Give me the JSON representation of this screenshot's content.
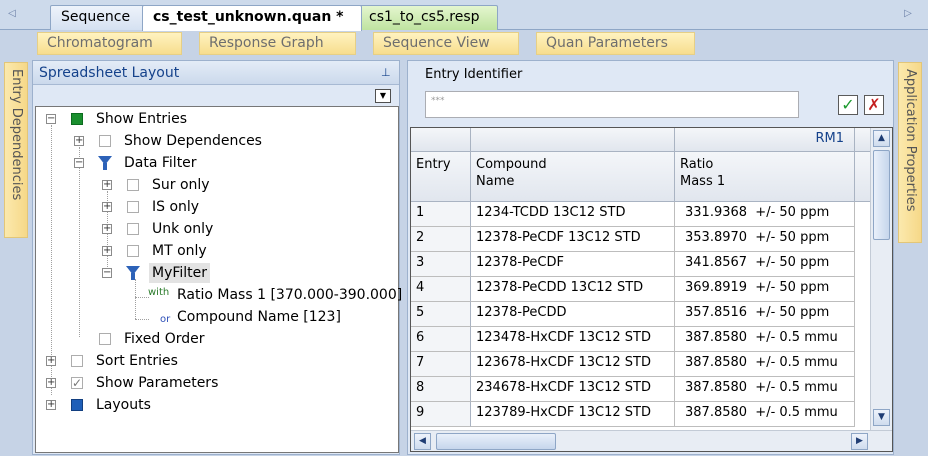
{
  "doc_tabs": [
    {
      "label": "Sequence"
    },
    {
      "label": "cs_test_unknown.quan *"
    },
    {
      "label": "cs1_to_cs5.resp"
    }
  ],
  "view_tabs": [
    {
      "label": "Chromatogram"
    },
    {
      "label": "Response Graph"
    },
    {
      "label": "Sequence View"
    },
    {
      "label": "Quan Parameters"
    }
  ],
  "side_tabs": {
    "left": "Entry Dependencies",
    "right": "Application Properties"
  },
  "left_panel": {
    "title": "Spreadsheet Layout",
    "tree": {
      "show_entries": "Show Entries",
      "show_dependences": "Show Dependences",
      "data_filter": "Data Filter",
      "sur_only": "Sur only",
      "is_only": "IS only",
      "unk_only": "Unk only",
      "mt_only": "MT only",
      "my_filter": "MyFilter",
      "with_label": "with",
      "or_label": "or",
      "cond_ratio": "Ratio Mass 1 [370.000-390.000]",
      "cond_compound": "Compound Name [123]",
      "fixed_order": "Fixed Order",
      "sort_entries": "Sort Entries",
      "show_parameters": "Show Parameters",
      "layouts": "Layouts"
    }
  },
  "right_panel": {
    "entry_identifier_label": "Entry Identifier",
    "entry_identifier_value": "***",
    "grid": {
      "group_header": "RM1",
      "col_entry": "Entry",
      "col_compound_line1": "Compound",
      "col_compound_line2": "Name",
      "col_ratio_line1": "Ratio",
      "col_ratio_line2": "Mass 1",
      "rows": [
        {
          "entry": "1",
          "compound": "1234-TCDD 13C12 STD",
          "ratio": "331.9368",
          "tol": "+/- 50 ppm"
        },
        {
          "entry": "2",
          "compound": "12378-PeCDF 13C12 STD",
          "ratio": "353.8970",
          "tol": "+/- 50 ppm"
        },
        {
          "entry": "3",
          "compound": "12378-PeCDF",
          "ratio": "341.8567",
          "tol": "+/- 50 ppm"
        },
        {
          "entry": "4",
          "compound": "12378-PeCDD 13C12 STD",
          "ratio": "369.8919",
          "tol": "+/- 50 ppm"
        },
        {
          "entry": "5",
          "compound": "12378-PeCDD",
          "ratio": "357.8516",
          "tol": "+/- 50 ppm"
        },
        {
          "entry": "6",
          "compound": "123478-HxCDF 13C12 STD",
          "ratio": "387.8580",
          "tol": "+/- 0.5 mmu"
        },
        {
          "entry": "7",
          "compound": "123678-HxCDF 13C12 STD",
          "ratio": "387.8580",
          "tol": "+/- 0.5 mmu"
        },
        {
          "entry": "8",
          "compound": "234678-HxCDF 13C12 STD",
          "ratio": "387.8580",
          "tol": "+/- 0.5 mmu"
        },
        {
          "entry": "9",
          "compound": "123789-HxCDF 13C12 STD",
          "ratio": "387.8580",
          "tol": "+/- 0.5 mmu"
        }
      ]
    }
  },
  "colors": {
    "panel_title": "#15428b",
    "show_entries_check": "#1a8f2e",
    "layouts_check": "#1f5fb8",
    "accept": "#1b9a2e",
    "reject": "#c41f1f"
  }
}
